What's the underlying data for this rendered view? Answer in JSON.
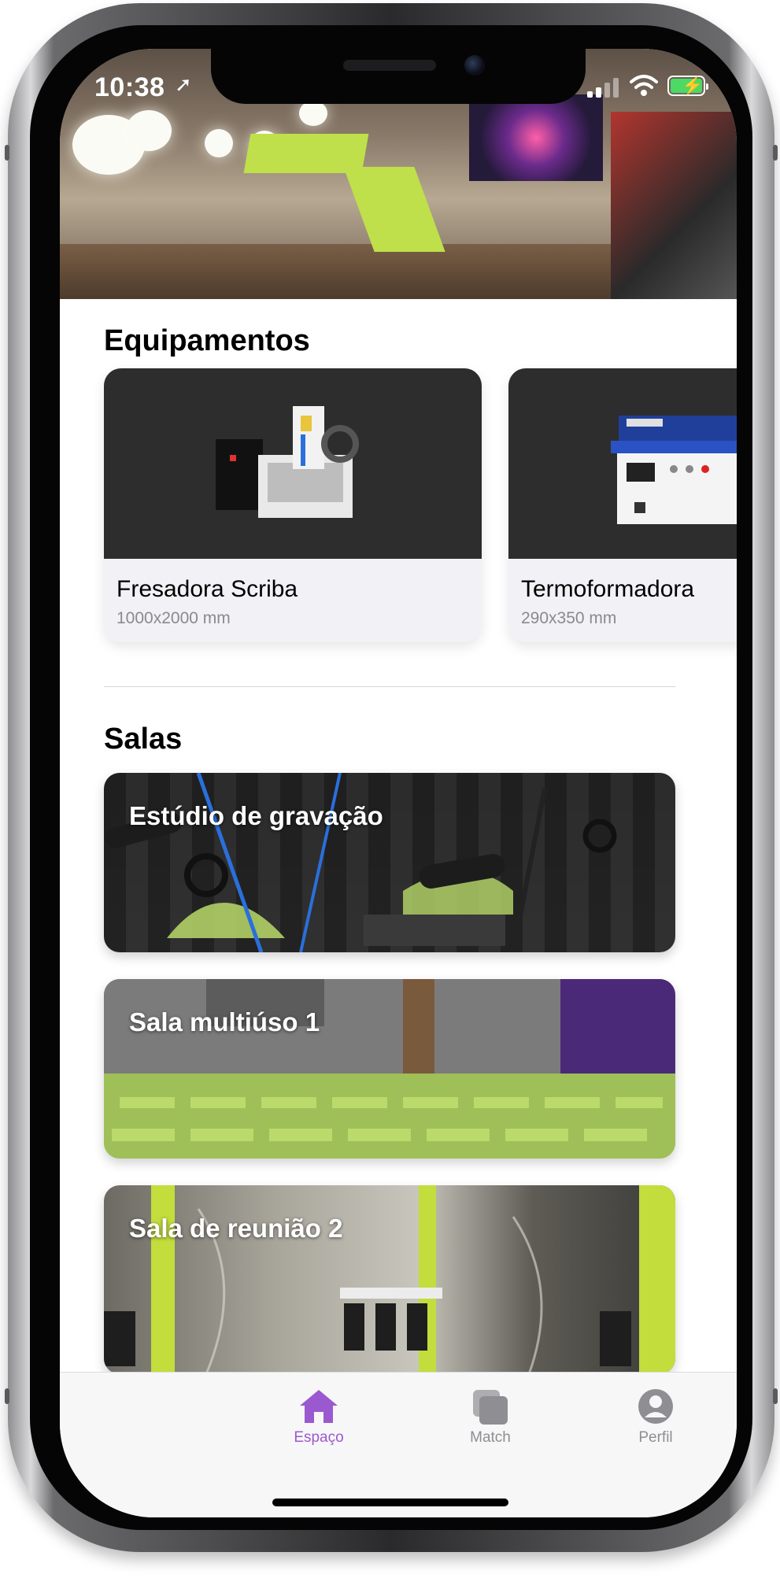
{
  "status_bar": {
    "time": "10:38"
  },
  "sections": {
    "equipment_title": "Equipamentos",
    "rooms_title": "Salas"
  },
  "equipment": [
    {
      "name": "Fresadora Scriba",
      "spec": "1000x2000 mm"
    },
    {
      "name": "Termoformadora",
      "spec": "290x350 mm"
    }
  ],
  "rooms": [
    {
      "name": "Estúdio de gravação"
    },
    {
      "name": "Sala multiúso 1"
    },
    {
      "name": "Sala de reunião 2"
    }
  ],
  "tab_bar": {
    "items": [
      {
        "label": "Espaço",
        "icon": "house-icon",
        "active": true
      },
      {
        "label": "Match",
        "icon": "stacked-cards-icon",
        "active": false
      },
      {
        "label": "Perfil",
        "icon": "person-circle-icon",
        "active": false
      }
    ]
  },
  "colors": {
    "accent": "#9b59d0",
    "inactive": "#8e8e93"
  }
}
